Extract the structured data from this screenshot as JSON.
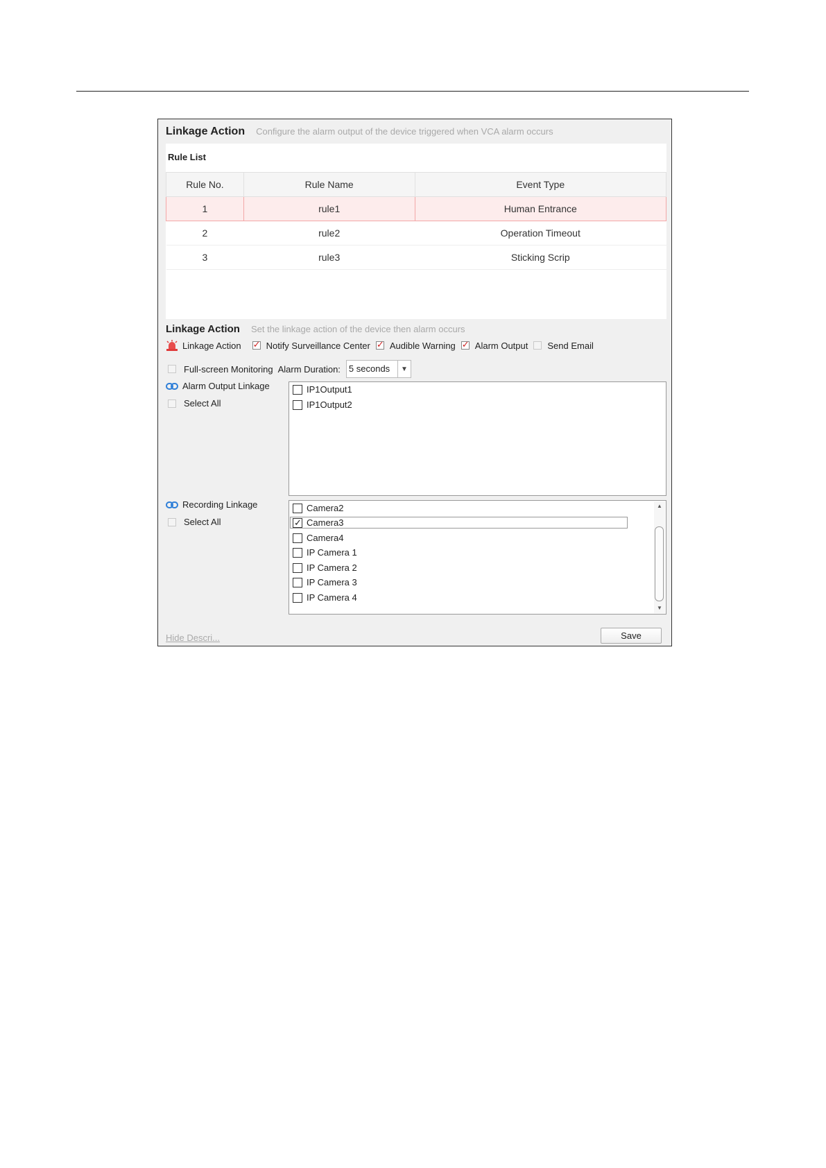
{
  "header": {
    "title": "Linkage Action",
    "description": "Configure the alarm output of the device triggered when VCA alarm occurs"
  },
  "rule_list": {
    "title": "Rule List",
    "columns": [
      "Rule No.",
      "Rule Name",
      "Event Type"
    ],
    "rows": [
      {
        "no": "1",
        "name": "rule1",
        "event": "Human Entrance",
        "selected": true
      },
      {
        "no": "2",
        "name": "rule2",
        "event": "Operation Timeout",
        "selected": false
      },
      {
        "no": "3",
        "name": "rule3",
        "event": "Sticking Scrip",
        "selected": false
      }
    ]
  },
  "linkage": {
    "title": "Linkage Action",
    "description": "Set the linkage action of the device then alarm occurs",
    "label": "Linkage Action",
    "icon": "alarm-siren-icon",
    "options": [
      {
        "label": "Notify Surveillance Center",
        "checked": true
      },
      {
        "label": "Audible Warning",
        "checked": true
      },
      {
        "label": "Alarm Output",
        "checked": true
      },
      {
        "label": "Send Email",
        "checked": false
      }
    ],
    "fullscreen": {
      "label": "Full-screen Monitoring",
      "checked": false
    },
    "alarm_duration": {
      "label": "Alarm Duration:",
      "value": "5 seconds"
    }
  },
  "alarm_output_linkage": {
    "label": "Alarm Output Linkage",
    "icon": "link-icon",
    "select_all": "Select All",
    "items": [
      {
        "label": "IP1Output1",
        "checked": false
      },
      {
        "label": "IP1Output2",
        "checked": false
      }
    ]
  },
  "recording_linkage": {
    "label": "Recording Linkage",
    "icon": "link-icon",
    "select_all": "Select All",
    "items": [
      {
        "label": "Camera2",
        "checked": false
      },
      {
        "label": "Camera3",
        "checked": true
      },
      {
        "label": "Camera4",
        "checked": false
      },
      {
        "label": "IP Camera 1",
        "checked": false
      },
      {
        "label": "IP Camera 2",
        "checked": false
      },
      {
        "label": "IP Camera 3",
        "checked": false
      },
      {
        "label": "IP Camera 4",
        "checked": false
      }
    ]
  },
  "footer": {
    "hide_link": "Hide Descri...",
    "save_label": "Save"
  },
  "colors": {
    "selected_row_bg": "#fdecec",
    "selected_row_border": "#f3a7a7",
    "check_red": "#d02525",
    "link_blue": "#2f7fd8"
  }
}
